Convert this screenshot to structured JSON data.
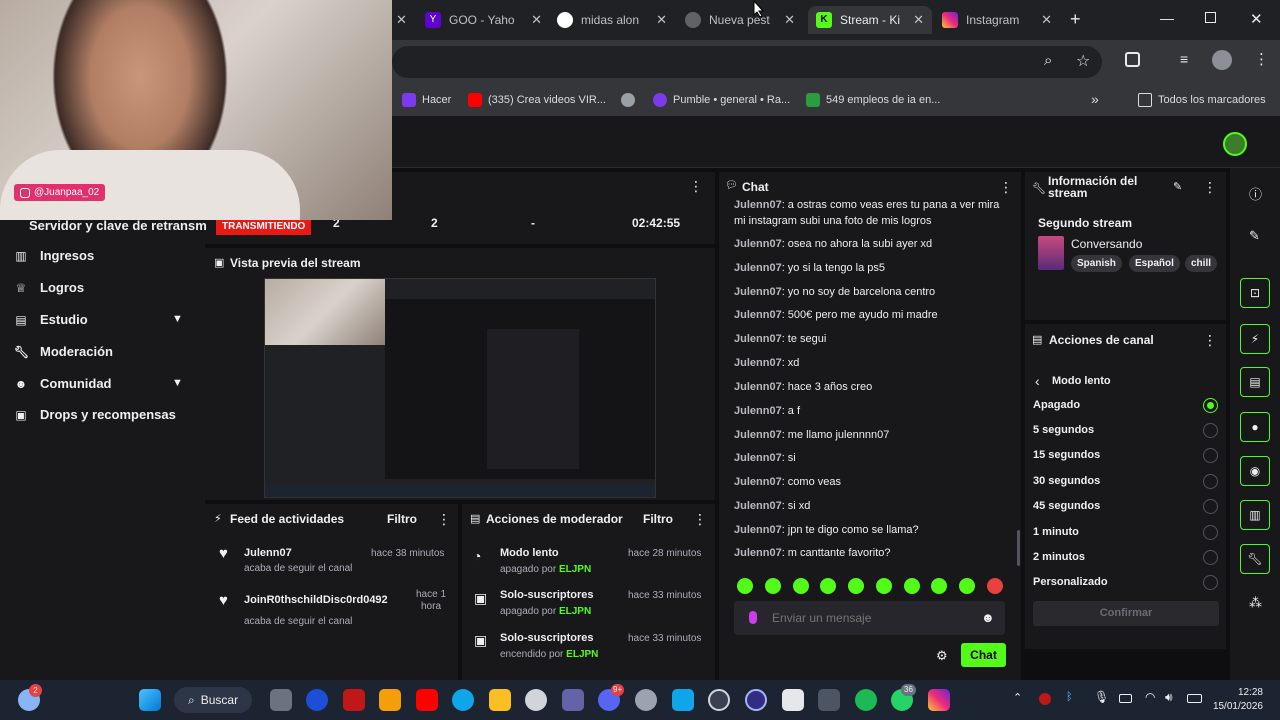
{
  "browser": {
    "tabs": [
      {
        "label": "GOO - Yaho",
        "color": "#5f01d1"
      },
      {
        "label": "midas alon",
        "color": "#ffffff"
      },
      {
        "label": "Nueva pest",
        "color": "#9aa0a6"
      },
      {
        "label": "Stream - Ki",
        "color": "#53fc18"
      },
      {
        "label": "Instagram",
        "color": "#e1306c"
      }
    ],
    "new_tab": "+",
    "bookmarks": [
      {
        "label": "Hacer",
        "color": "#7c3aed"
      },
      {
        "label": "(335) Crea videos VIR...",
        "color": "#ff0000"
      },
      {
        "label": "",
        "color": "#9aa0a6"
      },
      {
        "label": "Pumble • general • Ra...",
        "color": "#7c3aed"
      },
      {
        "label": "549 empleos de ia en...",
        "color": "#2a9d3c"
      }
    ],
    "all_bookmarks": "Todos los marcadores"
  },
  "webcam": {
    "handle": "@Juanpaa_02"
  },
  "stats": {
    "section_label": "Servidor y clave de retransm",
    "status_badge": "TRANSMITIENDO",
    "viewers": "2",
    "followers": "2",
    "subs": "-",
    "duration": "02:42:55"
  },
  "nav": {
    "items": [
      {
        "label": "Ingresos",
        "icon": "bar-chart-icon"
      },
      {
        "label": "Logros",
        "icon": "trophy-icon"
      },
      {
        "label": "Estudio",
        "icon": "layout-icon"
      },
      {
        "label": "Moderación",
        "icon": "wrench-icon"
      },
      {
        "label": "Comunidad",
        "icon": "users-icon"
      },
      {
        "label": "Drops y recompensas",
        "icon": "gift-icon"
      }
    ]
  },
  "preview": {
    "title": "Vista previa del stream"
  },
  "feed": {
    "title": "Feed de actividades",
    "filter": "Filtro",
    "items": [
      {
        "user": "Julenn07",
        "time": "hace 38 minutos",
        "action": "acaba de seguir el canal"
      },
      {
        "user": "JoinR0thschildDisc0rd0492",
        "time": "hace 1 hora",
        "action": "acaba de seguir el canal"
      }
    ]
  },
  "modactions": {
    "title": "Acciones de moderador",
    "filter": "Filtro",
    "items": [
      {
        "label": "Modo lento",
        "time": "hace 28 minutos",
        "state": "apagado",
        "by": "por",
        "mod": "ELJPN"
      },
      {
        "label": "Solo-suscriptores",
        "time": "hace 33 minutos",
        "state": "apagado",
        "by": "por",
        "mod": "ELJPN"
      },
      {
        "label": "Solo-suscriptores",
        "time": "hace 33 minutos",
        "state": "encendido",
        "by": "por",
        "mod": "ELJPN"
      }
    ]
  },
  "chat": {
    "title": "Chat",
    "messages": [
      {
        "user": "Julenn07",
        "text": ": a ostras como veas eres tu pana a ver mira"
      },
      {
        "user": "",
        "text": "mi instagram subi una foto de mis logros"
      },
      {
        "user": "Julenn07",
        "text": ": osea no ahora la subi ayer xd"
      },
      {
        "user": "Julenn07",
        "text": ": yo si la tengo la ps5"
      },
      {
        "user": "Julenn07",
        "text": ": yo no soy de barcelona centro"
      },
      {
        "user": "Julenn07",
        "text": ": 500€ pero me ayudo mi madre"
      },
      {
        "user": "Julenn07",
        "text": ": te segui"
      },
      {
        "user": "Julenn07",
        "text": ": xd"
      },
      {
        "user": "Julenn07",
        "text": ": hace 3 años creo"
      },
      {
        "user": "Julenn07",
        "text": ": a f"
      },
      {
        "user": "Julenn07",
        "text": ": me llamo julennnn07"
      },
      {
        "user": "Julenn07",
        "text": ": si"
      },
      {
        "user": "Julenn07",
        "text": ": como veas"
      },
      {
        "user": "Julenn07",
        "text": ": si xd"
      },
      {
        "user": "Julenn07",
        "text": ": jpn te digo como se llama?"
      },
      {
        "user": "Julenn07",
        "text": ": m canttante favorito?"
      }
    ],
    "placeholder": "Enviar un mensaje",
    "send_label": "Chat"
  },
  "info": {
    "title_line1": "Información del",
    "title_line2": "stream",
    "stream_title": "Segundo stream",
    "category": "Conversando",
    "tags": [
      "Spanish",
      "Español",
      "chill"
    ]
  },
  "channel": {
    "title": "Acciones de canal",
    "back_label": "Modo lento",
    "options": [
      "Apagado",
      "5 segundos",
      "15 segundos",
      "30 segundos",
      "45 segundos",
      "1 minuto",
      "2 minutos",
      "Personalizado"
    ],
    "selected": "Apagado",
    "confirm": "Confirmar"
  },
  "taskbar": {
    "search": "Buscar",
    "time": "12:28",
    "date": "15/01/2026",
    "badges": {
      "discord": "9+",
      "whatsapp": "36",
      "widgets": "2"
    }
  },
  "colors": {
    "accent": "#53fc18",
    "live": "#e91916",
    "panel": "#1f1f23"
  }
}
